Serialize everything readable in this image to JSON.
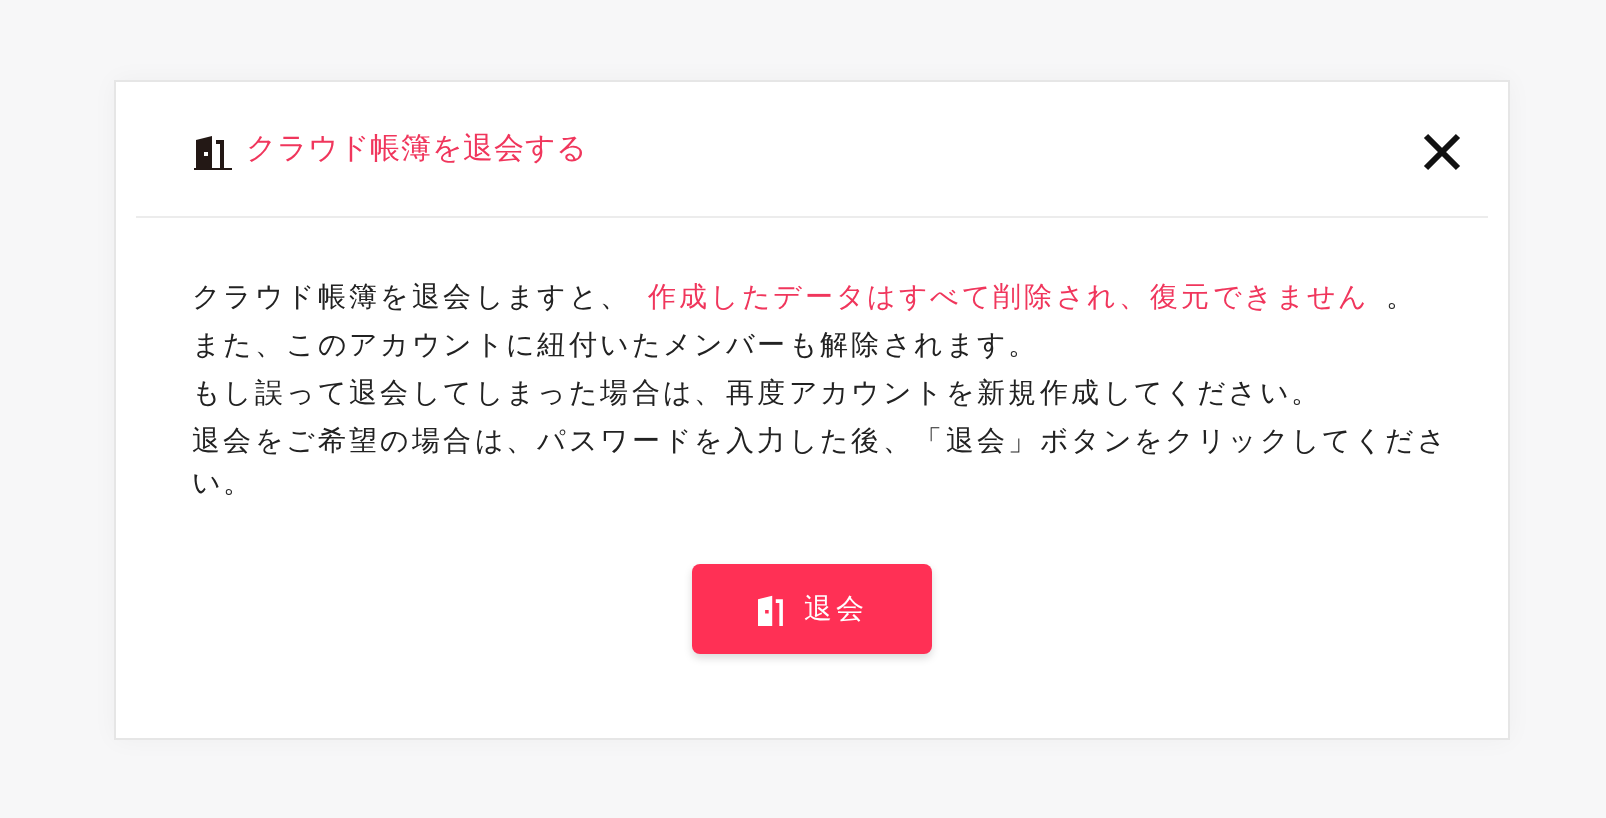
{
  "dialog": {
    "title": "クラウド帳簿を退会する",
    "message_lines": [
      {
        "segments": [
          {
            "text": "クラウド帳簿を退会しますと、",
            "emphasis": false
          },
          {
            "text": "作成したデータはすべて削除され、復元できません",
            "emphasis": true
          },
          {
            "text": "。",
            "emphasis": false
          }
        ]
      },
      {
        "segments": [
          {
            "text": "また、このアカウントに紐付いたメンバーも解除されます。",
            "emphasis": false
          }
        ]
      },
      {
        "segments": [
          {
            "text": "もし誤って退会してしまった場合は、再度アカウントを新規作成してください。",
            "emphasis": false
          }
        ]
      },
      {
        "segments": [
          {
            "text": "退会をご希望の場合は、パスワードを入力した後、「退会」ボタンをクリックしてください。",
            "emphasis": false
          }
        ]
      }
    ],
    "button": "退会"
  }
}
